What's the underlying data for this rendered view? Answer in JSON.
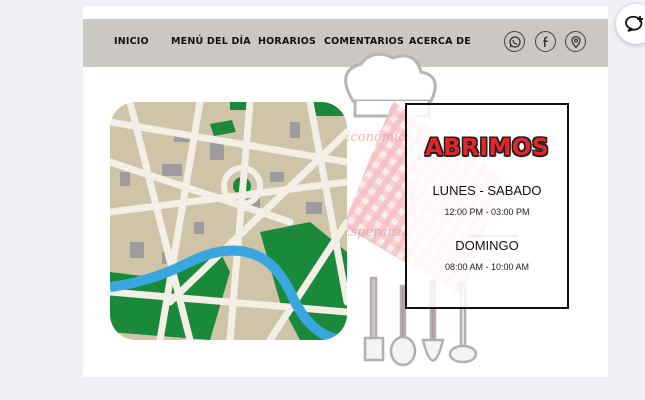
{
  "nav": {
    "items": [
      "INICIO",
      "MENÚ DEL DÍA",
      "HORARIOS",
      "COMENTARIOS",
      "ACERCA DE"
    ]
  },
  "social": {
    "icons": [
      "whatsapp-icon",
      "facebook-icon",
      "location-pin-icon"
    ]
  },
  "logo_watermark": {
    "line1": "Económica",
    "line2": "Esperanza"
  },
  "hours": {
    "heading": "ABRIMOS",
    "weekday_label": "LUNES - SABADO",
    "weekday_time": "12:00 PM - 03:00 PM",
    "weekend_label": "DOMINGO",
    "weekend_time": "08:00 AM - 10:00 AM"
  },
  "colors": {
    "navbar": "#cbc7c2",
    "heading_red": "#e3262c",
    "map_green": "#1a8a3a",
    "map_river": "#3aa6e0"
  }
}
